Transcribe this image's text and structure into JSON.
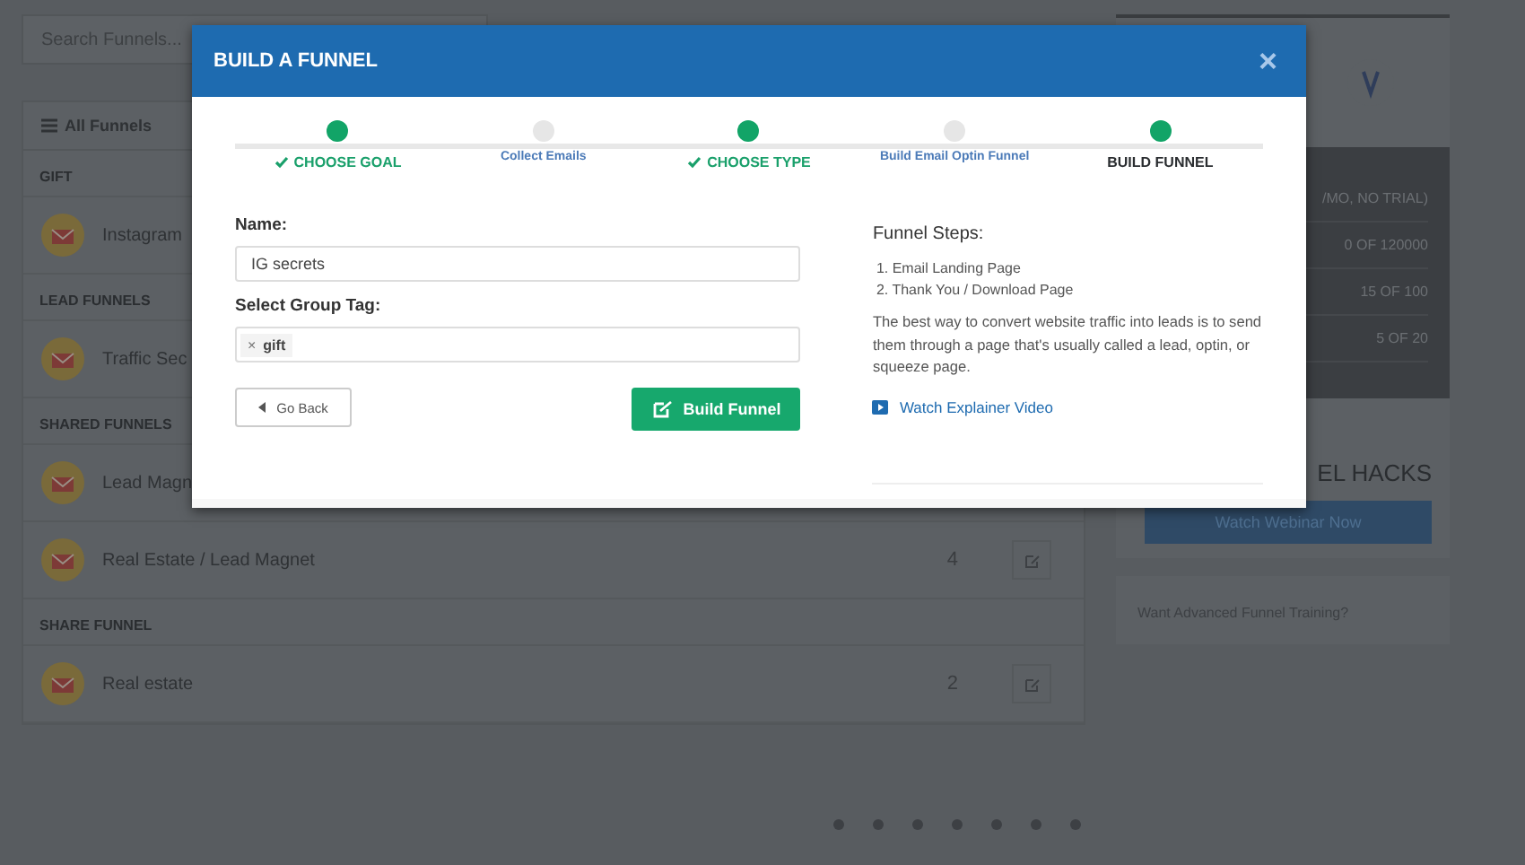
{
  "page": {
    "search": {
      "placeholder": "Search Funnels..."
    },
    "all_funnels": "All Funnels",
    "groups": [
      {
        "title": "GIFT",
        "funnels": [
          {
            "name": "Instagram"
          }
        ]
      },
      {
        "title": "LEAD FUNNELS",
        "funnels": [
          {
            "name": "Traffic Sec"
          }
        ]
      },
      {
        "title": "SHARED FUNNELS",
        "funnels": [
          {
            "name": "Lead Magn"
          },
          {
            "name": "Real Estate / Lead Magnet",
            "steps": "4"
          }
        ]
      },
      {
        "title": "SHARE FUNNEL",
        "funnels": [
          {
            "name": "Real estate",
            "steps": "2"
          }
        ]
      }
    ]
  },
  "sidebar": {
    "plan": "/MO, NO TRIAL)",
    "usage": [
      "0 OF 120000",
      "15 OF 100",
      "5 OF 20"
    ],
    "promo_title": "EL HACKS",
    "webinar_button": "Watch Webinar Now",
    "training_link": "Want Advanced Funnel Training?"
  },
  "modal": {
    "title": "BUILD A FUNNEL",
    "close": "×",
    "steps": [
      {
        "label": "CHOOSE GOAL",
        "kind": "done"
      },
      {
        "label": "Collect Emails",
        "kind": "pending"
      },
      {
        "label": "CHOOSE TYPE",
        "kind": "done"
      },
      {
        "label": "Build Email Optin Funnel",
        "kind": "pending"
      },
      {
        "label": "BUILD FUNNEL",
        "kind": "active"
      }
    ],
    "name_label": "Name:",
    "name_value": "IG secrets",
    "tag_label": "Select Group Tag:",
    "tags": [
      {
        "remove": "×",
        "label": "gift"
      }
    ],
    "back_button": "Go Back",
    "build_button": "Build Funnel",
    "steps_title": "Funnel Steps:",
    "funnel_steps": [
      "1. Email Landing Page",
      "2. Thank You / Download Page"
    ],
    "description": "The best way to convert website traffic into leads is to send them through a page that's usually called a lead, optin, or squeeze page.",
    "video_link": "Watch Explainer Video"
  }
}
